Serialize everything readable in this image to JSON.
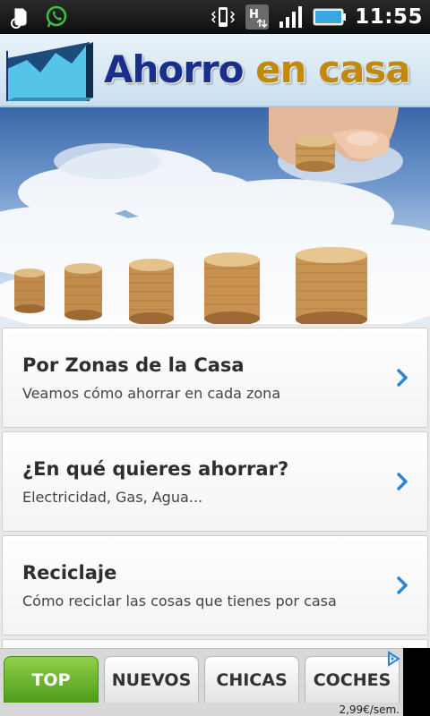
{
  "status_bar": {
    "time": "11:55",
    "left_icons": [
      "evernote-icon",
      "whatsapp-icon"
    ],
    "right_icons": [
      "vibrate-icon",
      "hsdpa-icon",
      "signal-icon",
      "battery-icon"
    ],
    "network_label": "H"
  },
  "header": {
    "title_part1": "Ahorro",
    "title_part2": "en casa"
  },
  "menu": {
    "items": [
      {
        "title": "Por Zonas de la Casa",
        "subtitle": "Veamos cómo ahorrar en cada zona"
      },
      {
        "title": "¿En qué quieres ahorrar?",
        "subtitle": "Electricidad, Gas, Agua..."
      },
      {
        "title": "Reciclaje",
        "subtitle": "Cómo reciclar las cosas que tienes por casa"
      }
    ]
  },
  "ad": {
    "tabs": [
      "TOP",
      "NUEVOS",
      "CHICAS",
      "COCHES"
    ],
    "active_tab": "TOP",
    "price": "2,99€/sem."
  },
  "colors": {
    "title_blue": "#1a2f8a",
    "title_gold": "#c08a10",
    "chevron_blue": "#2a86d6",
    "ad_active_green": "#5aa51f"
  }
}
